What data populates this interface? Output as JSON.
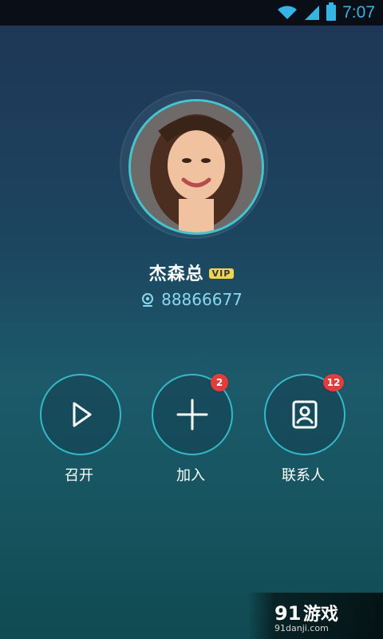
{
  "status_bar": {
    "time": "7:07",
    "icons": [
      "wifi-icon",
      "signal-icon",
      "battery-icon"
    ]
  },
  "profile": {
    "name": "杰森总",
    "vip": "VIP",
    "id": "88866677"
  },
  "actions": [
    {
      "label": "召开",
      "icon": "play-icon",
      "badge": null
    },
    {
      "label": "加入",
      "icon": "plus-icon",
      "badge": "2"
    },
    {
      "label": "联系人",
      "icon": "contacts-icon",
      "badge": "12"
    }
  ],
  "watermark": {
    "logo": "91游戏",
    "url": "91danji.com"
  },
  "colors": {
    "accent": "#35b8c9",
    "status_accent": "#35b5e5",
    "badge": "#e43b3b",
    "vip": "#f5d34a",
    "id_text": "#8ad8f0",
    "background_top": "#1f3556",
    "background_bottom": "#104a52"
  }
}
